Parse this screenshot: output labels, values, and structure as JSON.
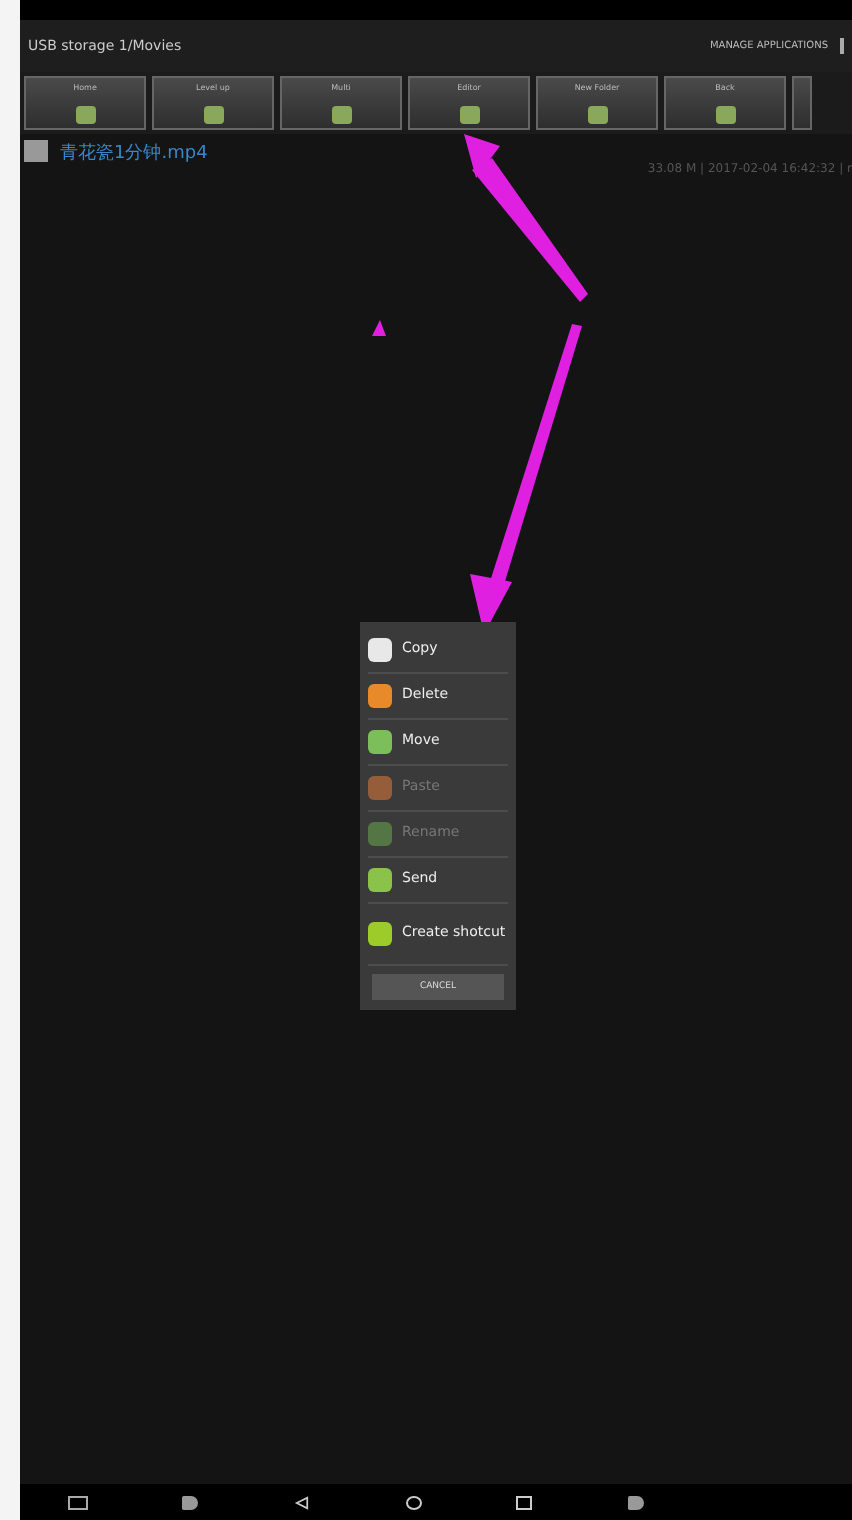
{
  "header": {
    "path": "USB storage 1/Movies",
    "action": "MANAGE APPLICATIONS"
  },
  "toolbar": [
    {
      "label": "Home"
    },
    {
      "label": "Level up"
    },
    {
      "label": "Multi"
    },
    {
      "label": "Editor"
    },
    {
      "label": "New Folder"
    },
    {
      "label": "Back"
    }
  ],
  "files": [
    {
      "name": "青花瓷1分钟.mp4",
      "meta": "33.08 M | 2017-02-04 16:42:32 | r"
    }
  ],
  "menu": {
    "items": [
      {
        "label": "Copy",
        "disabled": false,
        "kind": "copy"
      },
      {
        "label": "Delete",
        "disabled": false,
        "kind": "delete"
      },
      {
        "label": "Move",
        "disabled": false,
        "kind": "move"
      },
      {
        "label": "Paste",
        "disabled": true,
        "kind": "paste"
      },
      {
        "label": "Rename",
        "disabled": true,
        "kind": "rename"
      },
      {
        "label": "Send",
        "disabled": false,
        "kind": "send"
      },
      {
        "label": "Create shotcut",
        "disabled": false,
        "kind": "shortcut"
      }
    ],
    "cancel": "CANCEL"
  }
}
